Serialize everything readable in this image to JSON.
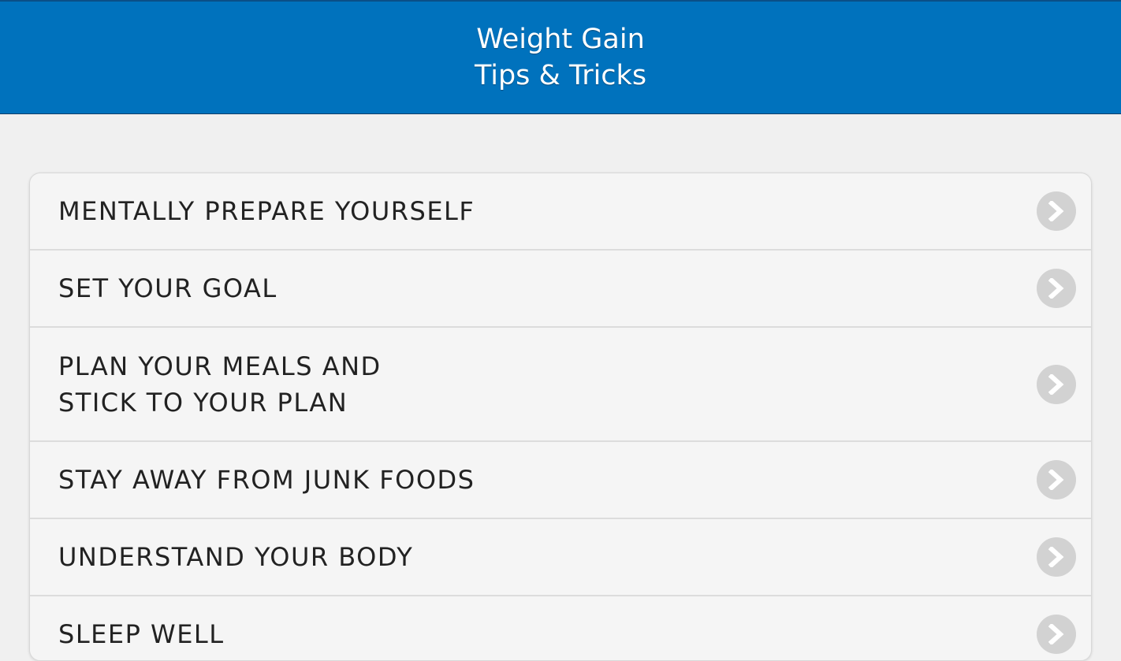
{
  "header": {
    "title_line1": "Weight Gain",
    "title_line2": "Tips & Tricks",
    "bg_color": "#0072bd"
  },
  "list": {
    "items": [
      {
        "label": "MENTALLY PREPARE YOURSELF",
        "icon": "chevron-right-icon"
      },
      {
        "label": "SET YOUR GOAL",
        "icon": "chevron-right-icon"
      },
      {
        "label": "PLAN YOUR MEALS AND\nSTICK TO YOUR PLAN",
        "icon": "chevron-right-icon"
      },
      {
        "label": "STAY AWAY FROM JUNK FOODS",
        "icon": "chevron-right-icon"
      },
      {
        "label": "UNDERSTAND YOUR BODY",
        "icon": "chevron-right-icon"
      },
      {
        "label": "SLEEP WELL",
        "icon": "chevron-right-icon"
      }
    ]
  }
}
